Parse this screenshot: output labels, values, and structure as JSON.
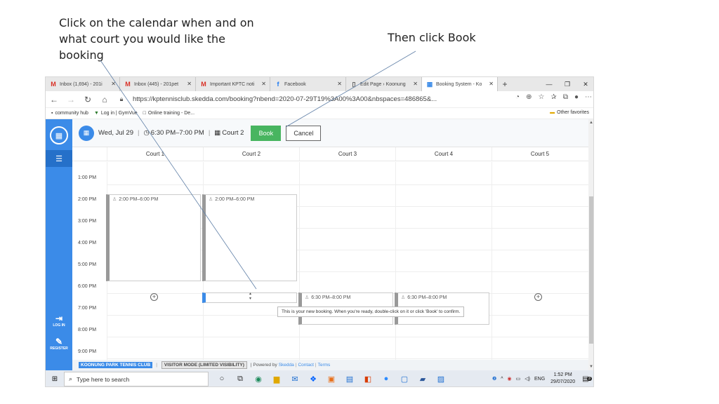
{
  "annotations": {
    "note1": "Click on the calendar when and on what court you would  like the booking",
    "note2": "Then click Book"
  },
  "browser": {
    "tabs": [
      {
        "icon": "M",
        "icon_color": "#d93025",
        "label": "Inbox (1,694) - 201i"
      },
      {
        "icon": "M",
        "icon_color": "#d93025",
        "label": "Inbox (445) - 201pet"
      },
      {
        "icon": "M",
        "icon_color": "#d93025",
        "label": "Important KPTC noti"
      },
      {
        "icon": "f",
        "icon_color": "#1877f2",
        "label": "Facebook"
      },
      {
        "icon": "▯",
        "icon_color": "#555555",
        "label": "Edit Page › Koonung"
      },
      {
        "icon": "▦",
        "icon_color": "#3b8be8",
        "label": "Booking System - Ko"
      }
    ],
    "new_tab": "+",
    "window_controls": [
      "—",
      "❐",
      "✕"
    ],
    "url": "https://kptennisclub.skedda.com/booking?nbend=2020-07-29T19%3A00%3A00&nbspaces=486865&...",
    "bookmarks": [
      {
        "icon": "▪",
        "label": "community  hub"
      },
      {
        "icon": "▼",
        "label": "Log in | GymVue"
      },
      {
        "icon": "□",
        "label": "Online training - De..."
      }
    ],
    "other_favorites": "Other favorites"
  },
  "booking": {
    "date": "Wed, Jul 29",
    "time": "6:30 PM–7:00 PM",
    "court": "Court 2",
    "book_label": "Book",
    "cancel_label": "Cancel"
  },
  "courts": [
    "Court 1",
    "Court 2",
    "Court 3",
    "Court 4",
    "Court 5"
  ],
  "times": [
    "1:00 PM",
    "2:00 PM",
    "3:00 PM",
    "4:00 PM",
    "5:00 PM",
    "6:00 PM",
    "7:00 PM",
    "8:00 PM",
    "9:00 PM"
  ],
  "events": {
    "court1": "2:00 PM–6:00 PM",
    "court2": "2:00 PM–6:00 PM",
    "court3": "6:30 PM–8:00 PM",
    "court4": "6:30 PM–8:00 PM"
  },
  "tooltip": "This is your new booking. When you're ready, double-click on it or click 'Book' to confirm.",
  "sidebar": {
    "login": "LOG IN",
    "register": "REGISTER"
  },
  "footer": {
    "club": "KOONUNG PARK TENNIS CLUB",
    "mode": "VISITOR MODE (LIMITED VISIBILITY)",
    "powered": "| Powered by",
    "skedda": "Skedda",
    "contact": "Contact",
    "terms": "Terms"
  },
  "taskbar": {
    "search_placeholder": "Type here to search",
    "lang": "ENG",
    "time": "1:52 PM",
    "date": "29/07/2020",
    "notifications": "3"
  },
  "colors": {
    "accent": "#3b8be8",
    "book_green": "#48b560"
  }
}
